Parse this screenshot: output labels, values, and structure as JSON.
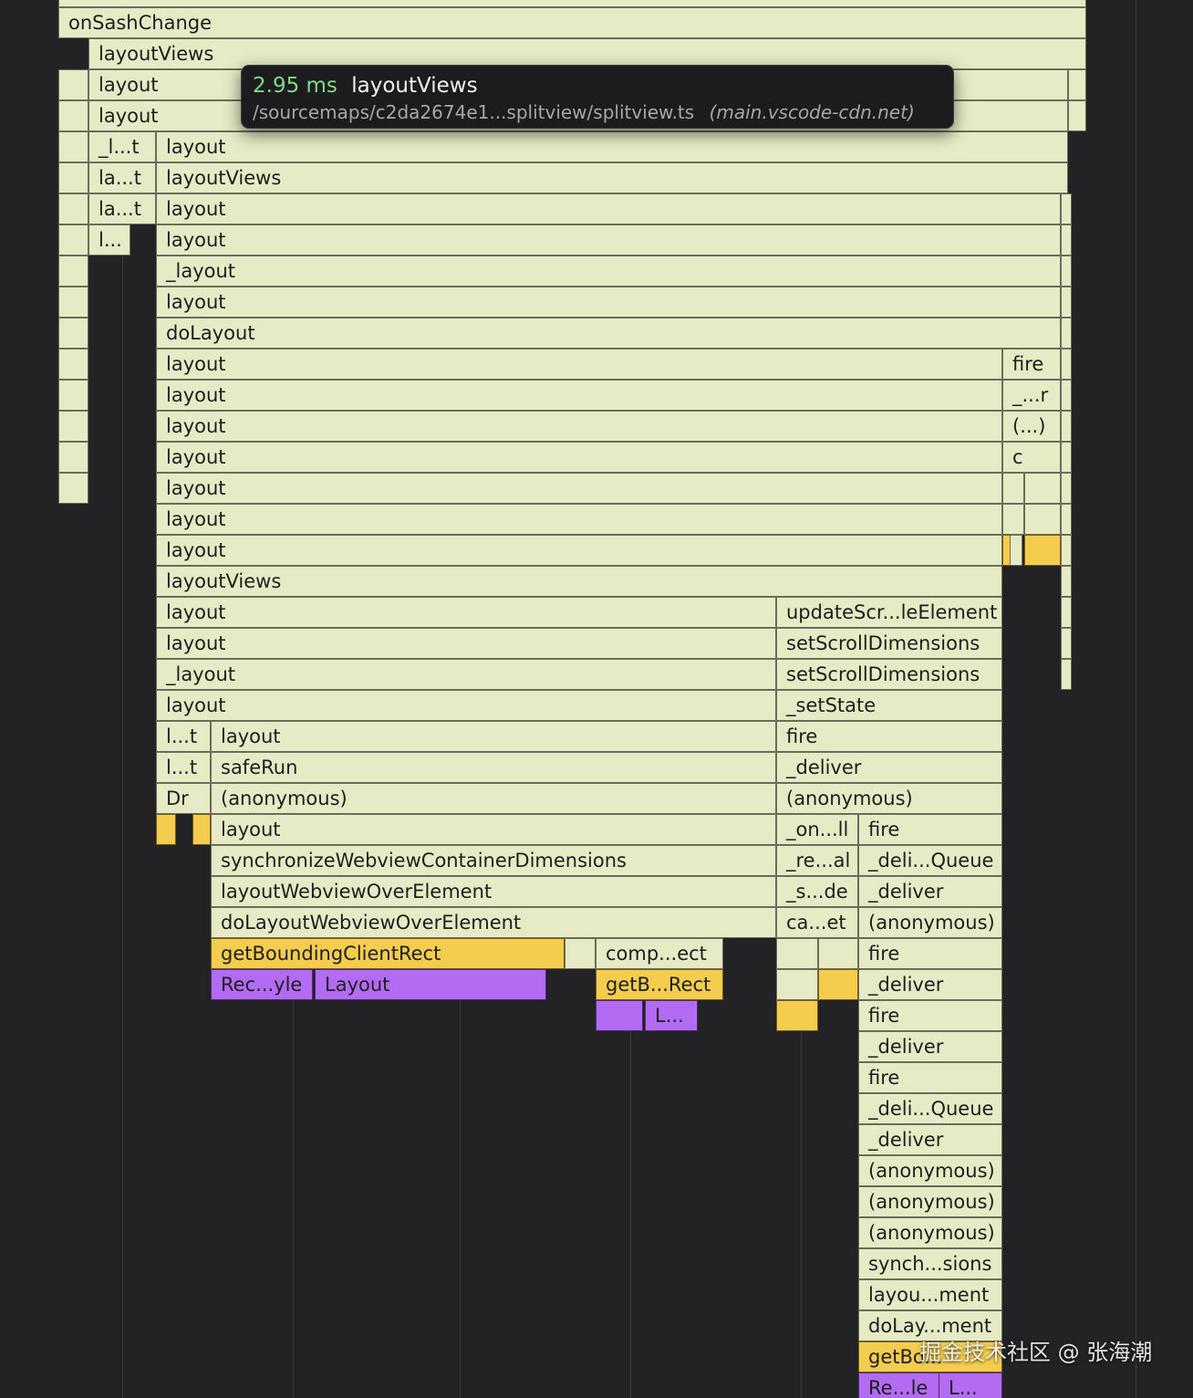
{
  "tooltip": {
    "duration": "2.95 ms",
    "name": "layoutViews",
    "path": "/sourcemaps/c2da2674e1...splitview/splitview.ts",
    "origin": "(main.vscode-cdn.net)"
  },
  "colors": {
    "background": "#232325",
    "js_frame": "#e6ebc5",
    "native_frame": "#f4cd4e",
    "render_frame": "#b46bf4",
    "tooltip_duration": "#7fd98a"
  },
  "frames": [
    {
      "label": "onSashChange",
      "kind": "js"
    },
    {
      "label": "layoutViews",
      "kind": "js"
    },
    {
      "label": "layout",
      "kind": "js"
    },
    {
      "label": "layout",
      "kind": "js"
    },
    {
      "label": "_l...t",
      "kind": "js"
    },
    {
      "label": "layout",
      "kind": "js"
    },
    {
      "label": "la...t",
      "kind": "js"
    },
    {
      "label": "layoutViews",
      "kind": "js"
    },
    {
      "label": "la...t",
      "kind": "js"
    },
    {
      "label": "layout",
      "kind": "js"
    },
    {
      "label": "l...",
      "kind": "js"
    },
    {
      "label": "layout",
      "kind": "js"
    },
    {
      "label": "_layout",
      "kind": "js"
    },
    {
      "label": "layout",
      "kind": "js"
    },
    {
      "label": "doLayout",
      "kind": "js"
    },
    {
      "label": "layout",
      "kind": "js"
    },
    {
      "label": "fire",
      "kind": "js"
    },
    {
      "label": "layout",
      "kind": "js"
    },
    {
      "label": "_...r",
      "kind": "js"
    },
    {
      "label": "layout",
      "kind": "js"
    },
    {
      "label": "(...)",
      "kind": "js"
    },
    {
      "label": "layout",
      "kind": "js"
    },
    {
      "label": "c",
      "kind": "js"
    },
    {
      "label": "layout",
      "kind": "js"
    },
    {
      "label": "layout",
      "kind": "js"
    },
    {
      "label": "layout",
      "kind": "js"
    },
    {
      "label": "layoutViews",
      "kind": "js"
    },
    {
      "label": "layout",
      "kind": "js"
    },
    {
      "label": "updateScr...leElement",
      "kind": "js"
    },
    {
      "label": "layout",
      "kind": "js"
    },
    {
      "label": "setScrollDimensions",
      "kind": "js"
    },
    {
      "label": "_layout",
      "kind": "js"
    },
    {
      "label": "setScrollDimensions",
      "kind": "js"
    },
    {
      "label": "layout",
      "kind": "js"
    },
    {
      "label": "_setState",
      "kind": "js"
    },
    {
      "label": "l...t",
      "kind": "js"
    },
    {
      "label": "layout",
      "kind": "js"
    },
    {
      "label": "fire",
      "kind": "js"
    },
    {
      "label": "l...t",
      "kind": "js"
    },
    {
      "label": "safeRun",
      "kind": "js"
    },
    {
      "label": "_deliver",
      "kind": "js"
    },
    {
      "label": "Dr",
      "kind": "js"
    },
    {
      "label": "(anonymous)",
      "kind": "js"
    },
    {
      "label": "(anonymous)",
      "kind": "js"
    },
    {
      "label": "layout",
      "kind": "js"
    },
    {
      "label": "_on...ll",
      "kind": "js"
    },
    {
      "label": "fire",
      "kind": "js"
    },
    {
      "label": "synchronizeWebviewContainerDimensions",
      "kind": "js"
    },
    {
      "label": "_re...al",
      "kind": "js"
    },
    {
      "label": "_deli...Queue",
      "kind": "js"
    },
    {
      "label": "layoutWebviewOverElement",
      "kind": "js"
    },
    {
      "label": "_s...de",
      "kind": "js"
    },
    {
      "label": "_deliver",
      "kind": "js"
    },
    {
      "label": "doLayoutWebviewOverElement",
      "kind": "js"
    },
    {
      "label": "ca...et",
      "kind": "js"
    },
    {
      "label": "(anonymous)",
      "kind": "js"
    },
    {
      "label": "getBoundingClientRect",
      "kind": "native"
    },
    {
      "label": "comp...ect",
      "kind": "js"
    },
    {
      "label": "fire",
      "kind": "js"
    },
    {
      "label": "Rec...yle",
      "kind": "render"
    },
    {
      "label": "Layout",
      "kind": "render"
    },
    {
      "label": "getB...Rect",
      "kind": "native"
    },
    {
      "label": "_deliver",
      "kind": "js"
    },
    {
      "label": "L...",
      "kind": "render"
    },
    {
      "label": "fire",
      "kind": "js"
    },
    {
      "label": "_deliver",
      "kind": "js"
    },
    {
      "label": "fire",
      "kind": "js"
    },
    {
      "label": "_deli...Queue",
      "kind": "js"
    },
    {
      "label": "_deliver",
      "kind": "js"
    },
    {
      "label": "(anonymous)",
      "kind": "js"
    },
    {
      "label": "(anonymous)",
      "kind": "js"
    },
    {
      "label": "(anonymous)",
      "kind": "js"
    },
    {
      "label": "synch...sions",
      "kind": "js"
    },
    {
      "label": "layou...ment",
      "kind": "js"
    },
    {
      "label": "doLay...ment",
      "kind": "js"
    },
    {
      "label": "getBo...",
      "kind": "native"
    },
    {
      "label": "Re...le",
      "kind": "render"
    },
    {
      "label": "L...",
      "kind": "render"
    }
  ],
  "watermark": "掘金技术社区 @ 张海潮"
}
